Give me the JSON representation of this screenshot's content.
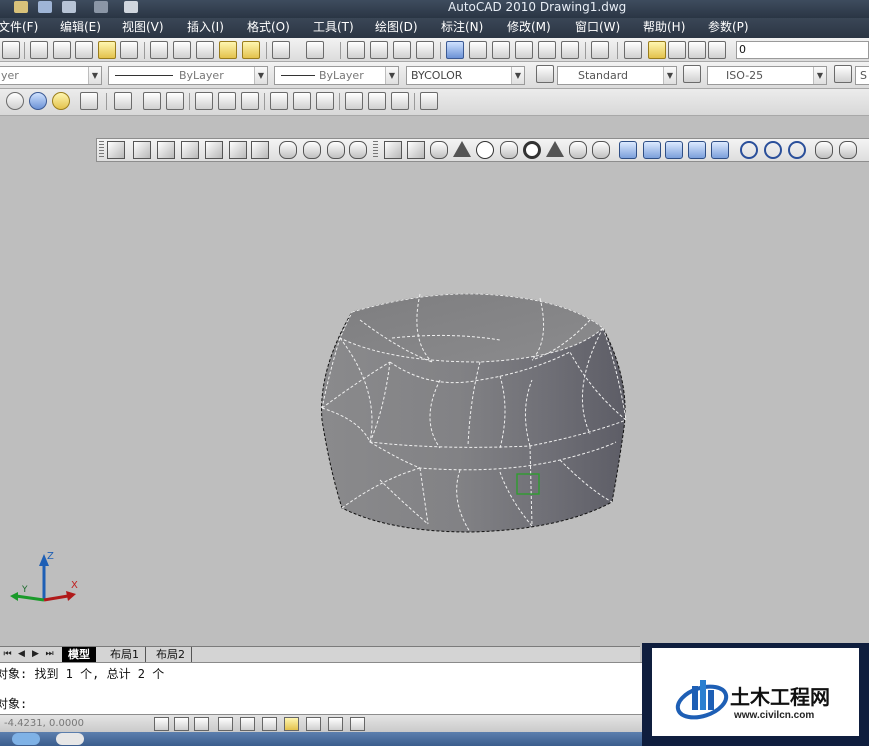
{
  "window": {
    "title": "AutoCAD 2010    Drawing1.dwg"
  },
  "menu": [
    {
      "label": "文件(F)"
    },
    {
      "label": "编辑(E)"
    },
    {
      "label": "视图(V)"
    },
    {
      "label": "插入(I)"
    },
    {
      "label": "格式(O)"
    },
    {
      "label": "工具(T)"
    },
    {
      "label": "绘图(D)"
    },
    {
      "label": "标注(N)"
    },
    {
      "label": "修改(M)"
    },
    {
      "label": "窗口(W)"
    },
    {
      "label": "帮助(H)"
    },
    {
      "label": "参数(P)"
    }
  ],
  "layer_toolbar": {
    "current_layer": "0"
  },
  "properties": {
    "layer_combo": "yer",
    "color_combo": "ByLayer",
    "linetype_combo": "ByLayer",
    "lineweight_combo": "BYCOLOR",
    "text_style": "Standard",
    "dim_style": "ISO-25",
    "table_style_prefix": "S"
  },
  "ucs": {
    "z": "Z",
    "y": "Y",
    "x": "X"
  },
  "tabs": [
    {
      "label": "模型",
      "active": true
    },
    {
      "label": "布局1",
      "active": false
    },
    {
      "label": "布局2",
      "active": false
    }
  ],
  "command": {
    "line1": "对象: 找到 1 个, 总计 2 个",
    "line2": "对象:"
  },
  "status": {
    "coords": "-4.4231, 0.0000"
  },
  "watermark": {
    "title": "土木工程网",
    "url": "www.civilcn.com"
  },
  "colors": {
    "title_bg": "#2f3a49",
    "viewport_bg": "#bebebe",
    "solid": "#7a7a80",
    "accent_blue": "#1e5fb5"
  }
}
